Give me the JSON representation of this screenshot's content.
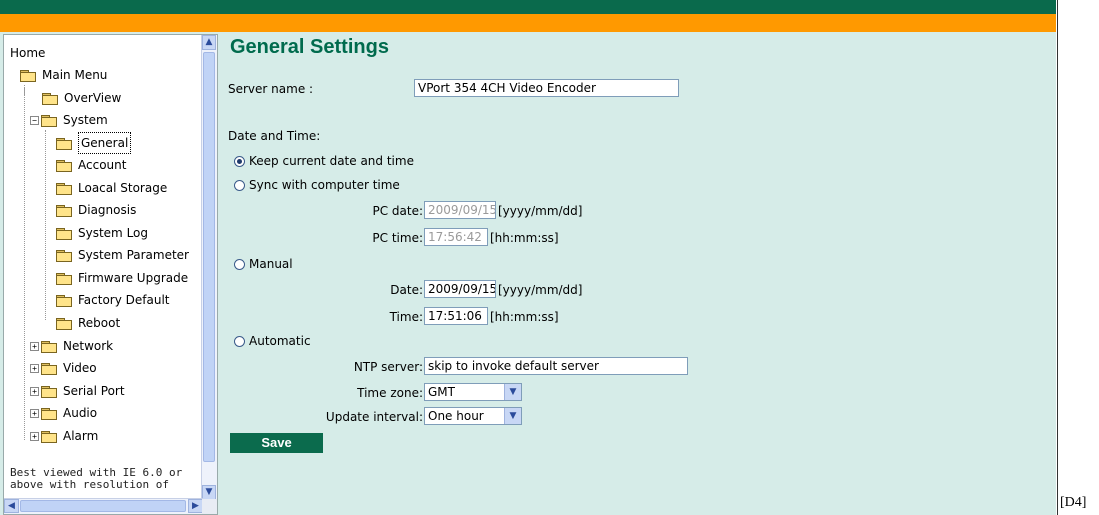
{
  "sidebar": {
    "items": [
      {
        "label": "Home"
      },
      {
        "label": "Main Menu"
      },
      {
        "label": "OverView"
      },
      {
        "label": "System"
      },
      {
        "label": "General"
      },
      {
        "label": "Account"
      },
      {
        "label": "Loacal Storage"
      },
      {
        "label": "Diagnosis"
      },
      {
        "label": "System Log"
      },
      {
        "label": "System Parameter"
      },
      {
        "label": "Firmware Upgrade"
      },
      {
        "label": "Factory Default"
      },
      {
        "label": "Reboot"
      },
      {
        "label": "Network"
      },
      {
        "label": "Video"
      },
      {
        "label": "Serial Port"
      },
      {
        "label": "Audio"
      },
      {
        "label": "Alarm"
      }
    ],
    "note": "Best viewed with IE 6.0 or above with resolution of"
  },
  "main": {
    "title": "General Settings",
    "server_name_label": "Server name :",
    "server_name_value": "VPort 354 4CH Video Encoder",
    "date_time_label": "Date and Time:",
    "options": {
      "keep": "Keep current date and time",
      "sync": "Sync with computer time",
      "manual": "Manual",
      "automatic": "Automatic"
    },
    "selected_option": "keep",
    "pc_date_label": "PC date:",
    "pc_date_value": "2009/09/15",
    "pc_date_format": "[yyyy/mm/dd]",
    "pc_time_label": "PC time:",
    "pc_time_value": "17:56:42",
    "pc_time_format": "[hh:mm:ss]",
    "date_label": "Date:",
    "date_value": "2009/09/15",
    "date_format": "[yyyy/mm/dd]",
    "time_label": "Time:",
    "time_value": "17:51:06",
    "time_format": "[hh:mm:ss]",
    "ntp_label": "NTP server:",
    "ntp_value": "skip to invoke default server",
    "timezone_label": "Time zone:",
    "timezone_value": "GMT",
    "interval_label": "Update interval:",
    "interval_value": "One hour",
    "save_label": "Save"
  },
  "corner_tag": "[D4]",
  "colors": {
    "header_green": "#0a6a4c",
    "header_orange": "#ff9900",
    "content_bg": "#d6ece8",
    "title_green": "#006b4d",
    "save_button": "#0b6b4d"
  }
}
